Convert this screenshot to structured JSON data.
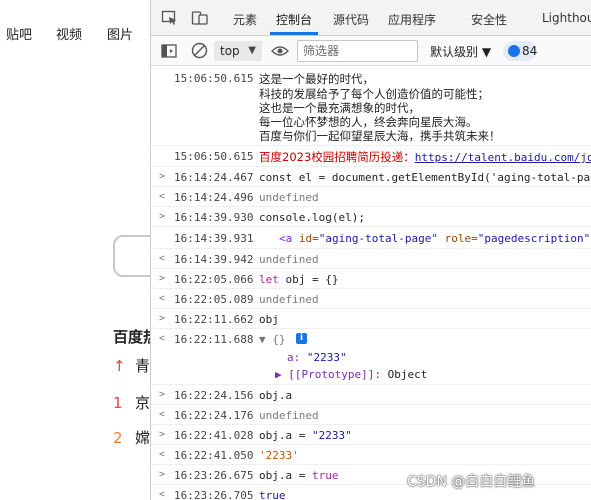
{
  "webpage": {
    "nav": [
      "贴吧",
      "视频",
      "图片"
    ],
    "hot_title": "百度热",
    "hot_items": [
      {
        "rank": "↑",
        "rank_color": "#f04142",
        "text": "青",
        "text_color": "#222222"
      },
      {
        "rank": "1",
        "rank_color": "#f04142",
        "text": "京",
        "text_color": "#222222"
      },
      {
        "rank": "2",
        "rank_color": "#ff7a2f",
        "text": "嫦",
        "text_color": "#222222"
      }
    ]
  },
  "devtools": {
    "tabs": [
      "元素",
      "控制台",
      "源代码",
      "应用程序",
      "安全性",
      "Lighthouse"
    ],
    "active_tab": "控制台",
    "accent_color": "#1a73e8",
    "toolbar": {
      "context": "top",
      "filter_placeholder": "筛选器",
      "level": "默认级别 ▼",
      "issues_count": "84"
    }
  },
  "console": {
    "entries": [
      {
        "ts": "15:06:50.615",
        "lines": [
          "这是一个最好的时代，",
          "科技的发展给予了每个人创造价值的可能性；",
          "这也是一个最充满想象的时代，",
          "每一位心怀梦想的人，终会奔向星辰大海。",
          "百度与你们一起仰望星辰大海，携手共筑未来！"
        ]
      },
      {
        "ts": "15:06:50.615",
        "red_text": "百度2023校园招聘简历投递：",
        "link": "https://talent.baidu.com/jo"
      },
      {
        "marker": ">",
        "ts": "16:14:24.467",
        "code": "const el = document.getElementById('aging-total-page')"
      },
      {
        "marker": "<",
        "ts": "16:14:24.496",
        "result": "undefined"
      },
      {
        "marker": ">",
        "ts": "16:14:39.930",
        "code": "console.log(el);"
      },
      {
        "ts": "16:14:39.931",
        "el_tag": "<a",
        "el_attr1_name": " id=",
        "el_attr1_val": "\"aging-total-page\"",
        "el_attr2_name": " role=",
        "el_attr2_val": "\"pagedescription\""
      },
      {
        "marker": "<",
        "ts": "16:14:39.942",
        "result": "undefined"
      },
      {
        "marker": ">",
        "ts": "16:22:05.066",
        "code_kw": "let",
        "code_rest": " obj = {}"
      },
      {
        "marker": "<",
        "ts": "16:22:05.089",
        "result": "undefined"
      },
      {
        "marker": ">",
        "ts": "16:22:11.662",
        "code": "obj"
      },
      {
        "marker": "<",
        "ts": "16:22:11.688",
        "obj_head": "▼ {}",
        "obj_prop_key": "a:",
        "obj_prop_val": "\"2233\"",
        "obj_proto_key": "▶ [[Prototype]]:",
        "obj_proto_val": "Object"
      },
      {
        "marker": ">",
        "ts": "16:22:24.156",
        "code": "obj.a"
      },
      {
        "marker": "<",
        "ts": "16:22:24.176",
        "result": "undefined"
      },
      {
        "marker": ">",
        "ts": "16:22:41.028",
        "code_plain": "obj.a = ",
        "code_str": "\"2233\""
      },
      {
        "marker": "<",
        "ts": "16:22:41.050",
        "result_str": "'2233'"
      },
      {
        "marker": ">",
        "ts": "16:23:26.675",
        "code_plain": "obj.a = ",
        "code_kw2": "true"
      },
      {
        "marker": "<",
        "ts": "16:23:26.705",
        "result_kw": "true"
      }
    ]
  },
  "watermark": "CSDN @白白白鲤鱼"
}
